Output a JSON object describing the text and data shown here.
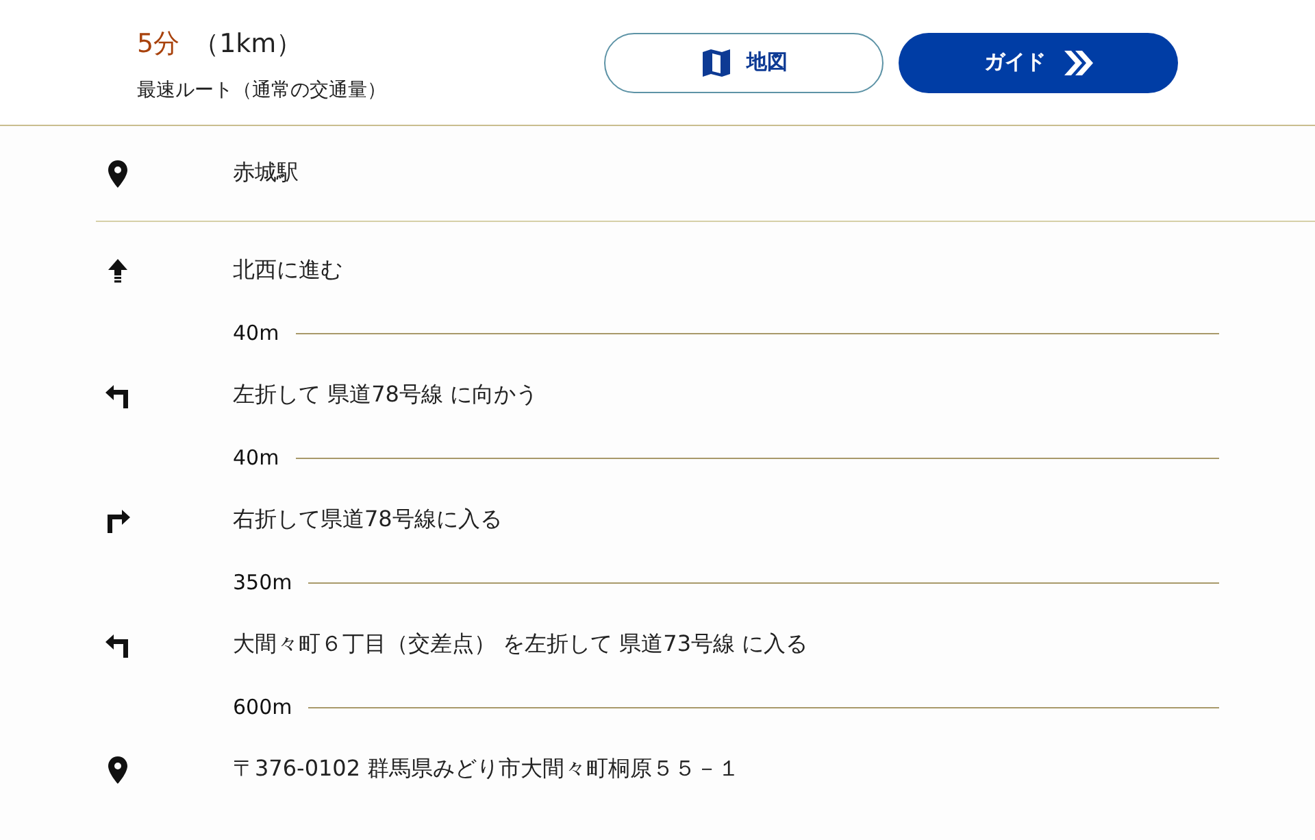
{
  "summary": {
    "time": "5分",
    "distance": "（1km）",
    "route": "最速ルート（通常の交通量）"
  },
  "buttons": [
    {
      "kind": "map",
      "label": "地図"
    },
    {
      "kind": "guide",
      "label": "ガイド"
    }
  ],
  "origin": {
    "kind": "pin",
    "text": "赤城駅"
  },
  "steps": [
    {
      "kind": "straight",
      "text": "北西に進む",
      "distance": "40m"
    },
    {
      "kind": "left",
      "text": "左折して 県道78号線 に向かう",
      "distance": "40m"
    },
    {
      "kind": "right",
      "text": "右折して県道78号線に入る",
      "distance": "350m"
    },
    {
      "kind": "left",
      "text": "大間々町６丁目（交差点） を左折して 県道73号線 に入る",
      "distance": "600m"
    }
  ],
  "destination": {
    "kind": "pin",
    "text": "〒376-0102 群馬県みどり市大間々町桐原５５－１"
  }
}
